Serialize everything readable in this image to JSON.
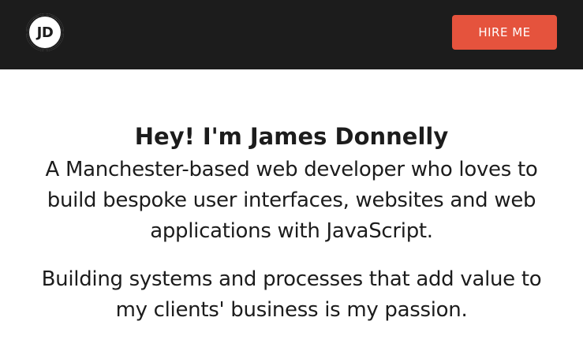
{
  "header": {
    "logo_text": "JD",
    "hire_button_label": "HIRE ME"
  },
  "hero": {
    "title": "Hey! I'm James Donnelly",
    "intro": "A Manchester-based web developer who loves to build bespoke user interfaces, websites and web applications with JavaScript.",
    "passion": "Building systems and processes that add value to my clients' business is my passion."
  },
  "colors": {
    "header_bg": "#1c1c1c",
    "accent": "#e5533d",
    "text": "#1c1c1c",
    "page_bg": "#ffffff"
  }
}
